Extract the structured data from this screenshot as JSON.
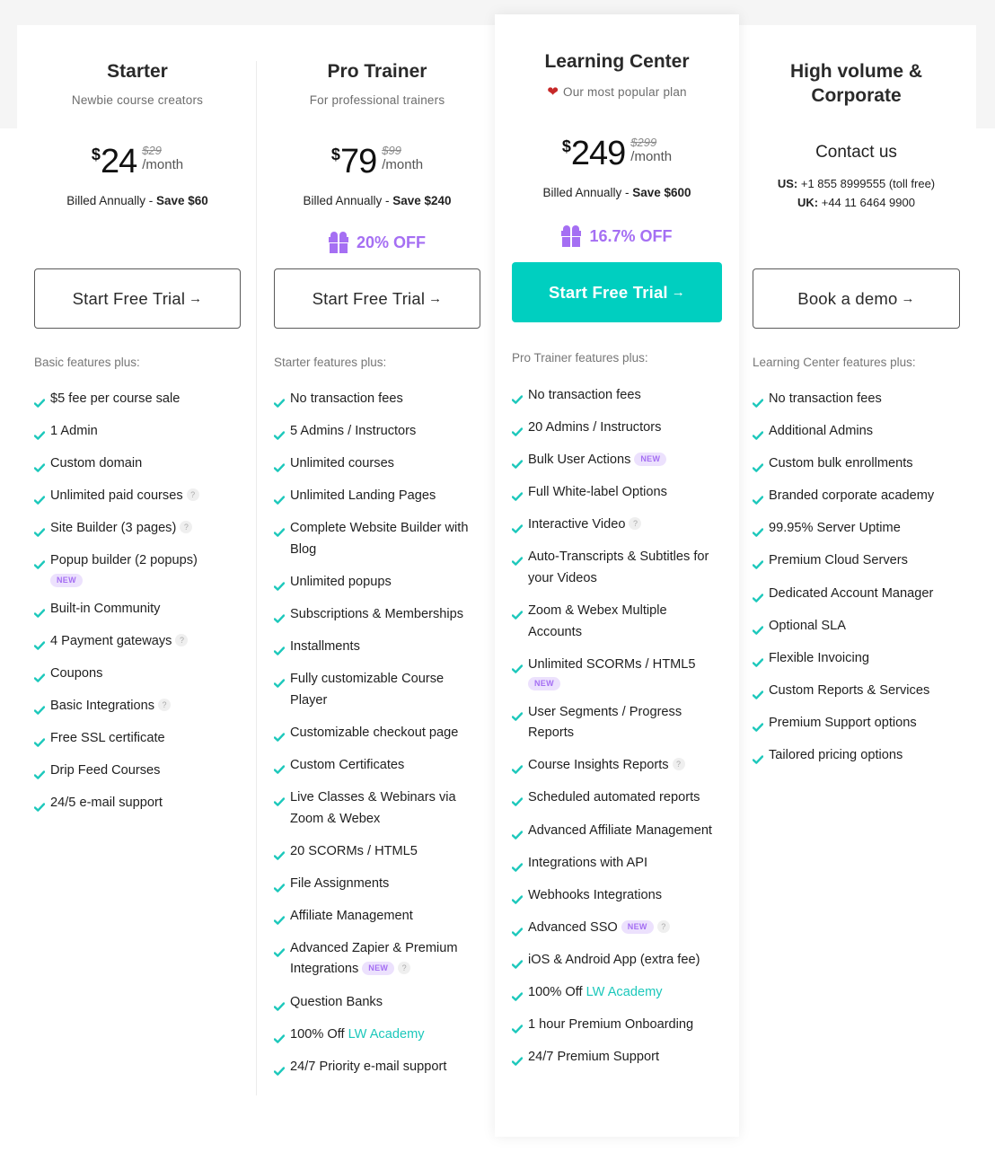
{
  "colors": {
    "accent": "#00cfc0",
    "discount": "#a56ff3",
    "heart": "#c62828",
    "new_badge_bg": "#ece1fd",
    "link": "#1cc8bb"
  },
  "plans": [
    {
      "title": "Starter",
      "subtitle": "Newbie course creators",
      "currency": "$",
      "price": "24",
      "old_price": "$29",
      "period": "/month",
      "billed_prefix": "Billed Annually - ",
      "billed_save": "Save $60",
      "cta_label": "Start Free Trial",
      "cta_arrow": "→",
      "features_heading": "Basic features plus:",
      "features": [
        {
          "text": "$5 fee per course sale"
        },
        {
          "text": "1 Admin"
        },
        {
          "text": "Custom domain"
        },
        {
          "text": "Unlimited paid courses",
          "help": "?"
        },
        {
          "text": "Site Builder (3 pages)",
          "help": "?"
        },
        {
          "text": "Popup builder (2 popups)",
          "badge": "NEW"
        },
        {
          "text": "Built-in Community"
        },
        {
          "text": "4 Payment gateways",
          "help": "?"
        },
        {
          "text": "Coupons"
        },
        {
          "text": "Basic Integrations",
          "help": "?"
        },
        {
          "text": "Free SSL certificate"
        },
        {
          "text": "Drip Feed Courses"
        },
        {
          "text": "24/5 e-mail support"
        }
      ]
    },
    {
      "title": "Pro Trainer",
      "subtitle": "For professional trainers",
      "currency": "$",
      "price": "79",
      "old_price": "$99",
      "period": "/month",
      "billed_prefix": "Billed Annually - ",
      "billed_save": "Save $240",
      "discount_label": "20% OFF",
      "discount_icon": "gift-icon",
      "cta_label": "Start Free Trial",
      "cta_arrow": "→",
      "features_heading": "Starter features plus:",
      "features": [
        {
          "text": "No transaction fees"
        },
        {
          "text": "5 Admins / Instructors"
        },
        {
          "text": "Unlimited courses"
        },
        {
          "text": "Unlimited Landing Pages"
        },
        {
          "text": "Complete Website Builder with Blog"
        },
        {
          "text": "Unlimited popups"
        },
        {
          "text": "Subscriptions & Memberships"
        },
        {
          "text": "Installments"
        },
        {
          "text": "Fully customizable Course Player"
        },
        {
          "text": "Customizable checkout page"
        },
        {
          "text": "Custom Certificates"
        },
        {
          "text": "Live Classes & Webinars via Zoom & Webex"
        },
        {
          "text": "20 SCORMs / HTML5"
        },
        {
          "text": "File Assignments"
        },
        {
          "text": "Affiliate Management"
        },
        {
          "text": "Advanced Zapier & Premium Integrations",
          "badge": "NEW",
          "help": "?"
        },
        {
          "text": "Question Banks"
        },
        {
          "text": "100% Off ",
          "link": "LW Academy"
        },
        {
          "text": "24/7 Priority e-mail support"
        }
      ]
    },
    {
      "title": "Learning Center",
      "subtitle": "Our most popular plan",
      "subtitle_icon": "heart-icon",
      "currency": "$",
      "price": "249",
      "old_price": "$299",
      "period": "/month",
      "billed_prefix": "Billed Annually - ",
      "billed_save": "Save $600",
      "discount_label": "16.7% OFF",
      "discount_icon": "gift-icon",
      "cta_label": "Start Free Trial",
      "cta_arrow": "→",
      "features_heading": "Pro Trainer features plus:",
      "features": [
        {
          "text": "No transaction fees"
        },
        {
          "text": "20 Admins / Instructors"
        },
        {
          "text": "Bulk User Actions",
          "badge": "NEW"
        },
        {
          "text": "Full White-label Options"
        },
        {
          "text": "Interactive Video",
          "help": "?"
        },
        {
          "text": "Auto-Transcripts & Subtitles for your Videos"
        },
        {
          "text": "Zoom & Webex Multiple Accounts"
        },
        {
          "text": "Unlimited SCORMs / HTML5",
          "badge": "NEW"
        },
        {
          "text": "User Segments / Progress Reports"
        },
        {
          "text": "Course Insights Reports",
          "help": "?"
        },
        {
          "text": "Scheduled automated reports"
        },
        {
          "text": "Advanced Affiliate Management"
        },
        {
          "text": "Integrations with API"
        },
        {
          "text": "Webhooks Integrations"
        },
        {
          "text": "Advanced SSO",
          "badge": "NEW",
          "help": "?"
        },
        {
          "text": "iOS & Android App (extra fee)"
        },
        {
          "text": "100% Off ",
          "link": "LW Academy"
        },
        {
          "text": "1 hour Premium Onboarding"
        },
        {
          "text": "24/7 Premium Support"
        }
      ]
    },
    {
      "title": "High volume & Corporate",
      "contact_title": "Contact us",
      "contact_lines": [
        {
          "label": "US:",
          "value": " +1 855 8999555 (toll free)"
        },
        {
          "label": "UK:",
          "value": " +44 11 6464 9900"
        }
      ],
      "cta_label": "Book a demo",
      "cta_arrow": "→",
      "features_heading": "Learning Center features plus:",
      "features": [
        {
          "text": "No transaction fees"
        },
        {
          "text": "Additional Admins"
        },
        {
          "text": "Custom bulk enrollments"
        },
        {
          "text": "Branded corporate academy"
        },
        {
          "text": "99.95% Server Uptime"
        },
        {
          "text": "Premium Cloud Servers"
        },
        {
          "text": "Dedicated Account Manager"
        },
        {
          "text": "Optional SLA"
        },
        {
          "text": "Flexible Invoicing"
        },
        {
          "text": "Custom Reports & Services"
        },
        {
          "text": "Premium Support options"
        },
        {
          "text": "Tailored pricing options"
        }
      ]
    }
  ]
}
